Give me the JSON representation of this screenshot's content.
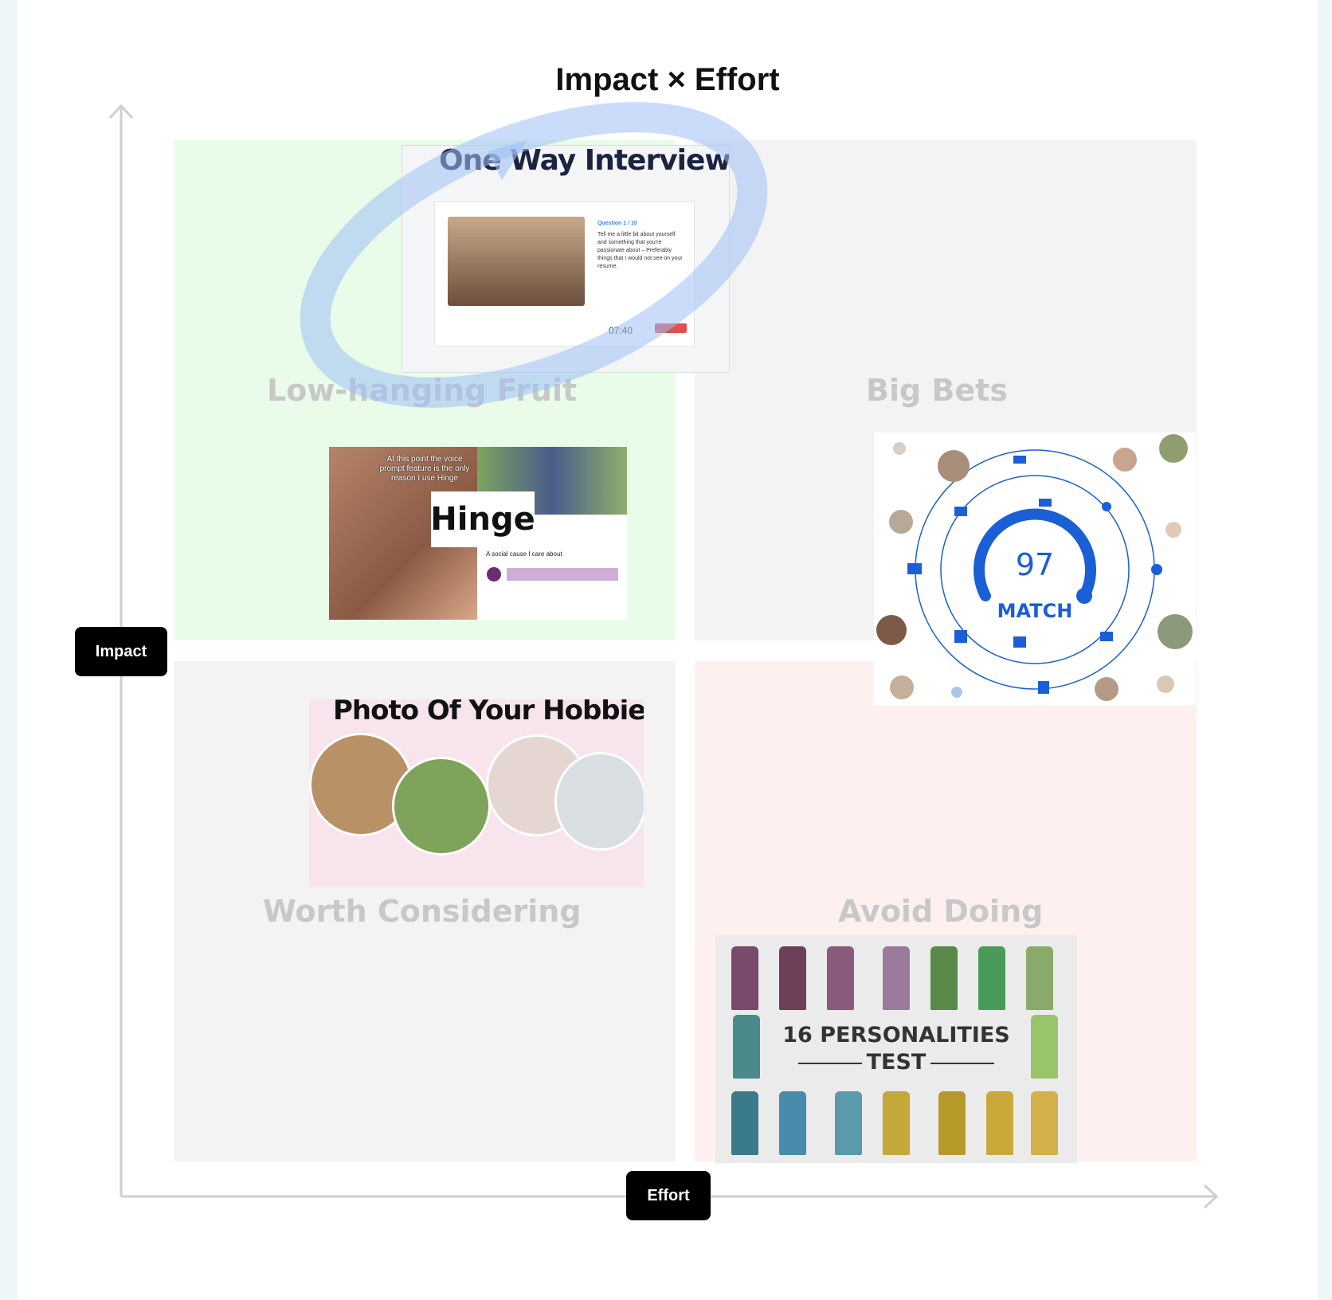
{
  "title": "Impact × Effort",
  "axes": {
    "y_label": "Impact",
    "x_label": "Effort"
  },
  "quadrants": {
    "top_left": "Low-hanging Fruit",
    "top_right": "Big Bets",
    "bottom_left": "Worth Considering",
    "bottom_right": "Avoid Doing"
  },
  "cards": {
    "one_way_interview": {
      "title": "One Way Interview",
      "question_number": "Question 1 / 10",
      "question_text": "Tell me a little bit about yourself and something that you're passionate about – Preferably things that I would not see on your resume.",
      "timer": "07:40"
    },
    "hinge": {
      "logo": "Hinge",
      "caption": "At this point the voice prompt feature is the only reason I use Hinge",
      "prompt": "A social cause I care about"
    },
    "match": {
      "score": "97",
      "label": "MATCH"
    },
    "hobbies": {
      "title": "Photo Of Your Hobbies"
    },
    "personalities": {
      "line1": "16 PERSONALITIES",
      "line2": "TEST"
    }
  },
  "colors": {
    "low_hanging": "#e9fce9",
    "big_bets": "#f3f3f3",
    "worth_considering": "#f3f3f3",
    "avoid_doing": "#fff0f0",
    "highlight_ring": "#9ec0f5",
    "match_blue": "#1a5fd6"
  }
}
